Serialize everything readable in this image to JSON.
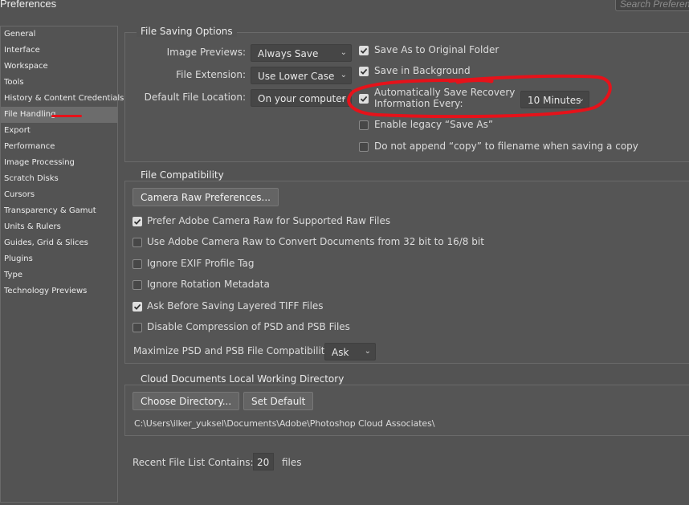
{
  "window": {
    "title": "Preferences",
    "search_placeholder": "Search Preferen"
  },
  "sidebar": {
    "items": [
      "General",
      "Interface",
      "Workspace",
      "Tools",
      "History & Content Credentials",
      "File Handling",
      "Export",
      "Performance",
      "Image Processing",
      "Scratch Disks",
      "Cursors",
      "Transparency & Gamut",
      "Units & Rulers",
      "Guides, Grid & Slices",
      "Plugins",
      "Type",
      "Technology Previews"
    ],
    "selected": "File Handling"
  },
  "file_saving": {
    "title": "File Saving Options",
    "image_previews_label": "Image Previews:",
    "image_previews_value": "Always Save",
    "file_extension_label": "File Extension:",
    "file_extension_value": "Use Lower Case",
    "default_location_label": "Default File Location:",
    "default_location_value": "On your computer",
    "save_original_folder": {
      "label": "Save As to Original Folder",
      "checked": true
    },
    "save_background": {
      "label": "Save in Background",
      "checked": true
    },
    "auto_save": {
      "label_line1": "Automatically Save Recovery",
      "label_line2": "Information Every:",
      "checked": true
    },
    "auto_save_interval": "10 Minutes",
    "legacy_save_as": {
      "label": "Enable legacy “Save As”",
      "checked": false
    },
    "no_copy": {
      "label": "Do not append “copy” to filename when saving a copy",
      "checked": false
    }
  },
  "file_compat": {
    "title": "File Compatibility",
    "camera_raw_button": "Camera Raw Preferences...",
    "options": [
      {
        "label": "Prefer Adobe Camera Raw for Supported Raw Files",
        "checked": true
      },
      {
        "label": "Use Adobe Camera Raw to Convert Documents from 32 bit to 16/8 bit",
        "checked": false
      },
      {
        "label": "Ignore EXIF Profile Tag",
        "checked": false
      },
      {
        "label": "Ignore Rotation Metadata",
        "checked": false
      },
      {
        "label": "Ask Before Saving Layered TIFF Files",
        "checked": true
      },
      {
        "label": "Disable Compression of PSD and PSB Files",
        "checked": false
      }
    ],
    "maximize_label": "Maximize PSD and PSB File Compatibility:",
    "maximize_value": "Ask"
  },
  "cloud": {
    "title": "Cloud Documents Local Working Directory",
    "choose_button": "Choose Directory...",
    "default_button": "Set Default",
    "path": "C:\\Users\\ilker_yuksel\\Documents\\Adobe\\Photoshop Cloud Associates\\"
  },
  "recent": {
    "label": "Recent File List Contains:",
    "value": "20",
    "unit": "files"
  },
  "colors": {
    "annotation": "#e6121a",
    "check_on": "#dedede",
    "panel": "#535353"
  },
  "icons": [
    "checkmark-icon",
    "chevron-down-icon"
  ]
}
